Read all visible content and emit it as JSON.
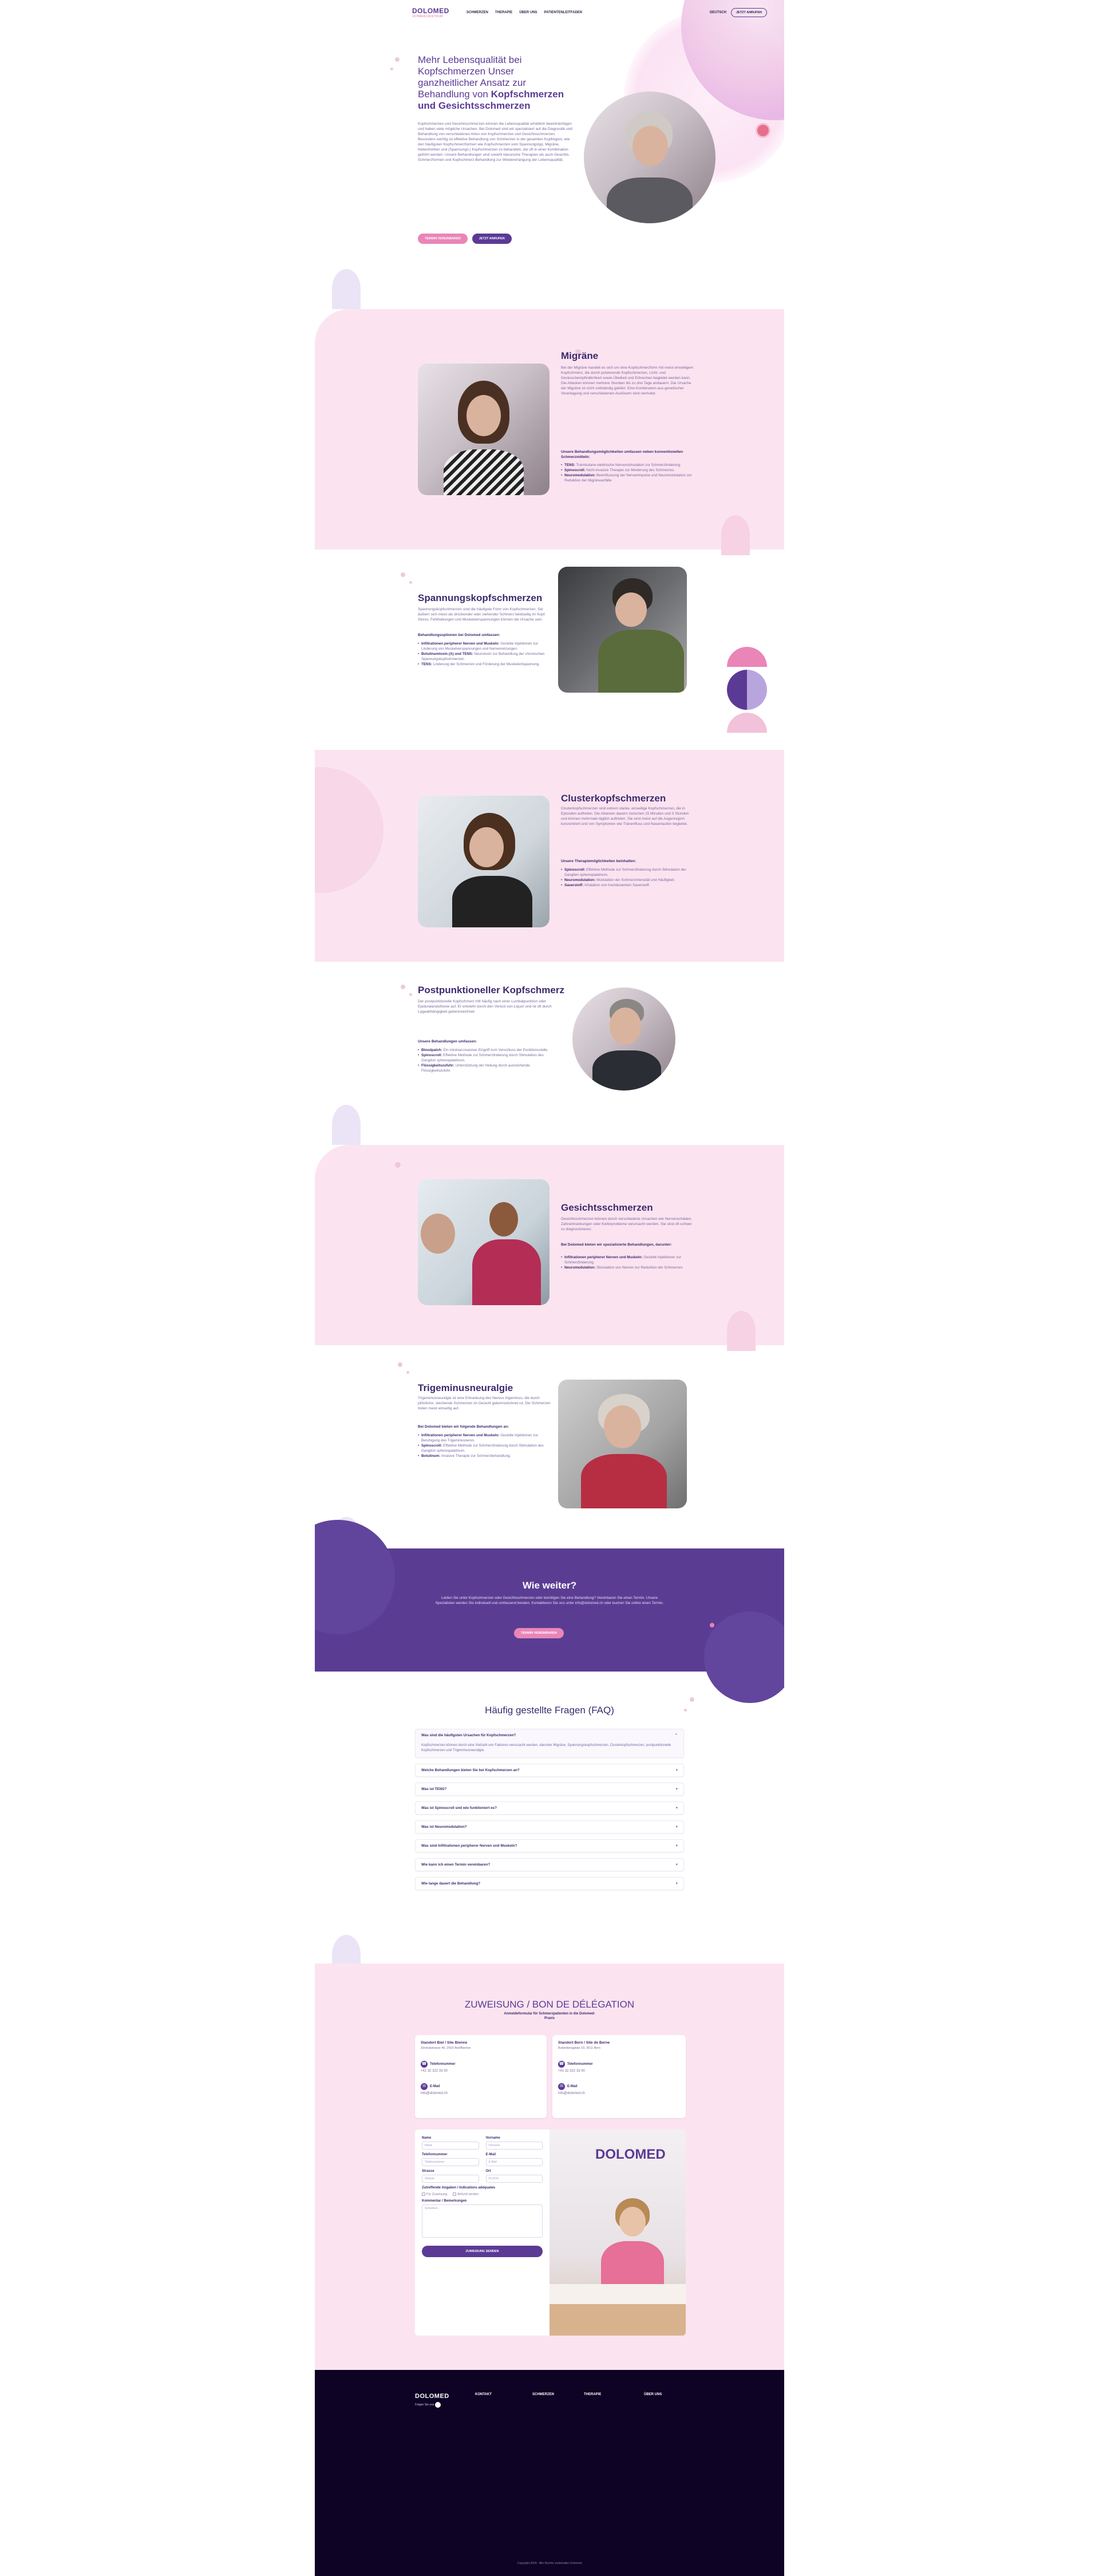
{
  "header": {
    "logo": "DOLOMED",
    "logo_sub": "SCHMERZZENTRUM",
    "nav": [
      "SCHMERZEN",
      "THERAPIE",
      "ÜBER UNS",
      "PATIENTENLEITFADEN"
    ],
    "lang": "DEUTSCH",
    "cta": "JETZT ANRUFEN"
  },
  "hero": {
    "title_plain": "Mehr Lebensqualität bei Kopfschmerzen Unser ganzheitlicher Ansatz zur Behandlung von",
    "title_bold": "Kopfschmerzen und Gesichtsschmerzen",
    "text": "Kopfschmerzen und Gesichtsschmerzen können die Lebensqualität erheblich beeinträchtigen und haben viele mögliche Ursachen. Bei Dolomed sind wir spezialisiert auf die Diagnostik und Behandlung von verschiedenen Arten von Kopfschmerzen und Gesichtsschmerzen. Besonders wichtig ist effektive Behandlung von Schmerzen in der gesamten Kopfregion, wie den häufigsten Kopfschmerzformen wie Kopfschmerzen vom Spannungstyp, Migräne, Nebenhöhlen und (Spannungs-) Kopfschmerzen zu behandeln, die oft in einer Kombination geführt werden. Unsere Behandlungen sind sowohl klassische Therapien als auch Gesichts-Schmerzformen und Kopfschmerz-Behandlung zur Wiedererlangung der Lebensqualität.",
    "btn1": "TERMIN VEREINBAREN",
    "btn2": "JETZT ANRUFEN"
  },
  "sections": {
    "migraene": {
      "title": "Migräne",
      "text": "Bei der Migräne handelt es sich um eine Kopfschmerzform mit meist einseitigem Kopfschmerz, die durch pulsierende Kopfschmerzen, Licht- und Geräuschempfindlichkeit sowie Übelkeit und Erbrechen begleitet werden kann. Die Attacken können mehrere Stunden bis zu drei Tage andauern. Die Ursache der Migräne ist nicht vollständig geklärt. Eine Kombination aus genetischer Veranlagung und verschiedenen Auslösern wird vermutet.",
      "sub": "Unsere Behandlungsmöglichkeiten umfassen neben konventionellen Schmerzmitteln:",
      "items": [
        {
          "b": "TENS:",
          "t": "Transkutane elektrische Nervenstimulation zur Schmerzlinderung."
        },
        {
          "b": "Spinoscroll:",
          "t": "Nicht-invasive Therapie zur Minderung des Schmerzes."
        },
        {
          "b": "Neuromodulation:",
          "t": "Beeinflussung der Nervenimpulse und Neuromodulation zur Reduktion der Migräneanfälle."
        }
      ]
    },
    "spannung": {
      "title": "Spannungskopfschmerzen",
      "text": "Spannungskopfschmerzen sind die häufigste Form von Kopfschmerzen. Sie äußern sich meist als drückender oder ziehender Schmerz beidseitig im Kopf. Stress, Fehlhaltungen und Muskelverspannungen können die Ursache sein.",
      "sub": "Behandlungsoptionen bei Dolomed umfassen:",
      "items": [
        {
          "b": "Infiltrationen peripherer Nerven und Muskeln:",
          "t": "Gezielte Injektionen zur Linderung von Muskelverspannungen und Nervenreizungen."
        },
        {
          "b": "Botulinumtoxin (A) und TENS:",
          "t": "Neurotoxin zur Behandlung der chronischen Spannungskopfschmerzen."
        },
        {
          "b": "TENS:",
          "t": "Linderung der Schmerzen und Förderung der Muskelentspannung."
        }
      ]
    },
    "cluster": {
      "title": "Clusterkopfschmerzen",
      "text": "Clusterkopfschmerzen sind extrem starke, einseitige Kopfschmerzen, die in Episoden auftreten. Die Attacken dauern zwischen 15 Minuten und 3 Stunden und können mehrmals täglich auftreten. Sie sind meist auf die Augenregion konzentriert und von Symptomen wie Tränenfluss und Nasenlaufen begleitet.",
      "sub": "Unsere Therapiemöglichkeiten beinhalten:",
      "items": [
        {
          "b": "Spinoscroll:",
          "t": "Effektive Methode zur Schmerzlinderung durch Stimulation der Ganglien sphenopalatinum."
        },
        {
          "b": "Neuromodulation:",
          "t": "Modulation der Schmerzintensität und Häufigkeit."
        },
        {
          "b": "Sauerstoff:",
          "t": "Inhalation von hochdosiertem Sauerstoff."
        }
      ]
    },
    "postpunktionell": {
      "title": "Postpunktioneller Kopfschmerz",
      "text": "Der postpunktionelle Kopfschmerz tritt häufig nach einer Lumbalpunktion oder Epiduralanästhesie auf. Er entsteht durch den Verlust von Liquor und ist oft durch Lageabhängigkeit gekennzeichnet.",
      "sub": "Unsere Behandlungen umfassen:",
      "items": [
        {
          "b": "Bloodpatch:",
          "t": "Ein minimal-invasiver Eingriff zum Verschluss der Punktionsstelle."
        },
        {
          "b": "Spinoscroll:",
          "t": "Effektive Methode zur Schmerzlinderung durch Stimulation des Ganglion sphenopalatinum."
        },
        {
          "b": "Flüssigkeitszufuhr:",
          "t": "Unterstützung der Heilung durch ausreichende Flüssigkeitszufuhr."
        }
      ]
    },
    "gesicht": {
      "title": "Gesichtsschmerzen",
      "text": "Gesichtsschmerzen können durch verschiedene Ursachen wie Nervenschäden, Zahnerkrankungen oder Kieferprobleme verursacht werden. Sie sind oft schwer zu diagnostizieren.",
      "sub": "Bei Dolomed bieten wir spezialisierte Behandlungen, darunter:",
      "items": [
        {
          "b": "Infiltrationen peripherer Nerven und Muskeln:",
          "t": "Gezielte Injektionen zur Schmerzlinderung."
        },
        {
          "b": "Neuromodulation:",
          "t": "Stimulation von Nerven zur Reduktion der Schmerzen."
        }
      ]
    },
    "trigeminus": {
      "title": "Trigeminusneuralgie",
      "text": "Trigeminusneuralgie ist eine Erkrankung des Nervus trigeminus, die durch plötzliche, stechende Schmerzen im Gesicht gekennzeichnet ist. Die Schmerzen treten meist einseitig auf.",
      "sub": "Bei Dolomed bieten wir folgende Behandlungen an:",
      "items": [
        {
          "b": "Infiltrationen peripherer Nerven und Muskeln:",
          "t": "Gezielte Injektionen zur Beruhigung des Trigeminusnervs."
        },
        {
          "b": "Spinoscroll:",
          "t": "Effektive Methode zur Schmerzlinderung durch Stimulation des Ganglion sphenopalatinum."
        },
        {
          "b": "Botulinum:",
          "t": "Invasive Therapie zur Schmerzbehandlung."
        }
      ]
    }
  },
  "wie_weiter": {
    "title": "Wie weiter?",
    "text": "Leiden Sie unter Kopfschmerzen oder Gesichtsschmerzen oder benötigen Sie eine Behandlung? Vereinbaren Sie einen Termin. Unsere Spezialisten werden Sie individuell und umfassend beraten. Kontaktieren Sie uns unter info@dolomed.ch oder buchen Sie online einen Termin.",
    "button": "TERMIN VEREINBAREN"
  },
  "faq": {
    "title": "Häufig gestellte Fragen (FAQ)",
    "open": {
      "q": "Was sind die häufigsten Ursachen für Kopfschmerzen?",
      "a": "Kopfschmerzen können durch eine Vielzahl von Faktoren verursacht werden, darunter Migräne, Spannungskopfschmerzen, Clusterkopfschmerzen, postpunktionelle Kopfschmerzen und Trigeminusneuralgie."
    },
    "items": [
      "Welche Behandlungen bieten Sie bei Kopfschmerzen an?",
      "Was ist TENS?",
      "Was ist Spinoscroll und wie funktioniert es?",
      "Was ist Neuromodulation?",
      "Was sind Infiltrationen peripherer Nerven und Muskeln?",
      "Wie kann ich einen Termin vereinbaren?",
      "Wie lange dauert die Behandlung?"
    ]
  },
  "zuweisung": {
    "title": "ZUWEISUNG / BON DE DÉLÉGATION",
    "sub": "Anmeldeformular für Schmerzpatienten in die Dolomed-Praxis",
    "cards": [
      {
        "title": "Standort Biel / Site Bienne",
        "addr": "Zentralstrasse 40, 2502 Biel/Bienne",
        "tel_label": "Telefonnummer",
        "tel": "+41 32 322 33 00",
        "mail_label": "E-Mail",
        "mail": "info@dolomed.ch"
      },
      {
        "title": "Standort Bern / Site de Berne",
        "addr": "Bubenbergplatz 10, 3011 Bern",
        "tel_label": "Telefonnummer",
        "tel": "+41 32 322 33 00",
        "mail_label": "E-Mail",
        "mail": "info@dolomed.ch"
      }
    ],
    "form": {
      "name": "Name",
      "vorname": "Vorname",
      "name_ph": "Name",
      "vorname_ph": "Vorname",
      "telefon": "Telefonnummer",
      "email": "E-Mail",
      "telefon_ph": "Telefonnummer",
      "email_ph": "E-Mail",
      "strasse": "Strasse",
      "ort": "Ort",
      "strasse_ph": "Strasse",
      "ort_ph": "PLZ/Ort",
      "art": "Zutreffende Angaben / Indications adéquates",
      "opt1": "Für Zuweisung",
      "opt2": "Befund senden",
      "kommentar": "Kommentar / Bemerkungen",
      "kommentar_ph": "Schreiben...",
      "submit": "ZUWEISUNG SENDEN"
    }
  },
  "footer": {
    "logo": "DOLOMED",
    "cols": [
      "KONTAKT",
      "SCHMERZEN",
      "THERAPIE",
      "ÜBER UNS"
    ],
    "small": "Folgen Sie uns",
    "copyright": "Copyright 2024 - Alle Rechte vorbehalten Dolomed"
  },
  "colors": {
    "primary": "#5b3a96",
    "accent": "#ea85b8",
    "pink_bg": "#fbe4f0",
    "footer": "#0e0324"
  }
}
